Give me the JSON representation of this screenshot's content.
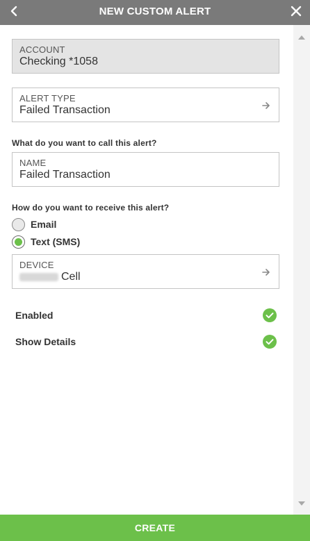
{
  "header": {
    "title": "NEW CUSTOM ALERT",
    "back_icon": "chevron-left-icon",
    "close_icon": "close-icon"
  },
  "account": {
    "label": "ACCOUNT",
    "value": "Checking *1058"
  },
  "alert_type": {
    "label": "ALERT TYPE",
    "value": "Failed Transaction"
  },
  "name_section": {
    "question": "What do you want to call this alert?",
    "label": "NAME",
    "value": "Failed Transaction"
  },
  "receive_section": {
    "question": "How do you want to receive this alert?",
    "options": [
      {
        "label": "Email",
        "selected": false
      },
      {
        "label": "Text (SMS)",
        "selected": true
      }
    ]
  },
  "device": {
    "label": "DEVICE",
    "value": "Cell"
  },
  "toggles": [
    {
      "label": "Enabled",
      "checked": true
    },
    {
      "label": "Show Details",
      "checked": true
    }
  ],
  "footer": {
    "create_label": "CREATE"
  },
  "colors": {
    "accent": "#6cc04a",
    "header_bg": "#7a7a7a",
    "readonly_bg": "#e4e4e4"
  }
}
